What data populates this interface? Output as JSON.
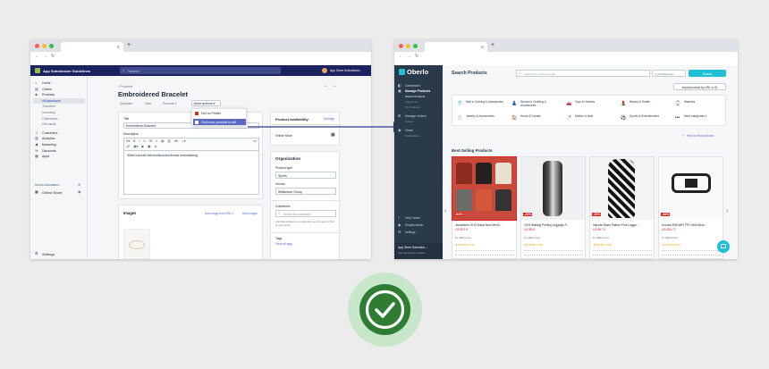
{
  "colors": {
    "shopify_topbar": "#1c2260",
    "oberlo_sidebar": "#2b3a4a",
    "oberlo_accent": "#1fc0d6",
    "arrow": "#2e3a8c",
    "check_circle": "#c8e6c9",
    "check_inner": "#2e7d32",
    "sale_red": "#e02020"
  },
  "left": {
    "topbar": {
      "store": "App Submission Guidelines",
      "search_placeholder": "Search",
      "account": "App Store Submission"
    },
    "nav": [
      {
        "label": "Home",
        "icon": "home-icon"
      },
      {
        "label": "Orders",
        "icon": "orders-icon"
      },
      {
        "label": "Products",
        "icon": "tag-icon"
      },
      {
        "label": "All products",
        "sub": true,
        "active": true
      },
      {
        "label": "Transfers",
        "sub": true
      },
      {
        "label": "Inventory",
        "sub": true
      },
      {
        "label": "Collections",
        "sub": true
      },
      {
        "label": "Gift cards",
        "sub": true
      },
      {
        "label": "Customers",
        "icon": "person-icon"
      },
      {
        "label": "Analytics",
        "icon": "chart-icon"
      },
      {
        "label": "Marketing",
        "icon": "megaphone-icon"
      },
      {
        "label": "Discounts",
        "icon": "discount-icon"
      },
      {
        "label": "Apps",
        "icon": "apps-icon"
      }
    ],
    "sales_channels": "SALES CHANNELS",
    "online_store": "Online Store",
    "settings": "Settings",
    "breadcrumb": "‹ Products",
    "title": "Embroidered Bracelet",
    "actions": {
      "duplicate": "Duplicate",
      "view": "View",
      "promote": "Promote ▾",
      "more": "More actions ▾"
    },
    "dropdown": [
      "Edit on Printful",
      "Find more products to sell"
    ],
    "form": {
      "title_label": "Title",
      "title_value": "Embroidered Bracelet",
      "description_label": "Description",
      "description_value": "Silver bracelet with multicolored thread embroidering"
    },
    "availability": {
      "heading": "Product availability",
      "manage": "Manage",
      "channel": "Online Store"
    },
    "organization": {
      "heading": "Organization",
      "type_label": "Product type",
      "type_value": "Sports",
      "vendor_label": "Vendor",
      "vendor_value": "Williamson Group",
      "collections_label": "Collections",
      "collections_placeholder": "Search for collections",
      "collections_help": "Add this product to a collection so it's easy to find in your store.",
      "tags_label": "Tags",
      "tags_link": "View all tags"
    },
    "images": {
      "heading": "Images",
      "add_url": "Add image from URL ▾",
      "add": "Add images"
    }
  },
  "right": {
    "logo": "Oberlo",
    "nav": [
      {
        "label": "Dashboard",
        "icon": "dashboard-icon"
      },
      {
        "label": "Manage Products",
        "icon": "box-icon",
        "active": true
      },
      {
        "label": "Search Products",
        "sub": true,
        "active": true
      },
      {
        "label": "Import List",
        "sub": true
      },
      {
        "label": "My Products",
        "sub": true
      },
      {
        "label": "Manage Orders",
        "icon": "cart-icon"
      },
      {
        "label": "Orders",
        "sub": true
      },
      {
        "label": "Views",
        "icon": "eye-icon"
      },
      {
        "label": "Notifications",
        "sub": true
      }
    ],
    "bottom_nav": [
      "Help Center",
      "Shopify Admin",
      "Settings"
    ],
    "store_name": "App Store Submissi...",
    "store_sub": "App Submission Guideli...",
    "heading": "Search Products",
    "search_placeholder": "Search for products to sell",
    "category_select": "In All Categories",
    "search_btn": "Search",
    "import_btn": "Import product by URL or ID",
    "categories": [
      {
        "label": "Men's Clothing & Accessories",
        "icon": "shirt-icon"
      },
      {
        "label": "Women's Clothing & Accessories",
        "icon": "dress-icon"
      },
      {
        "label": "Toys & Hobbies",
        "icon": "toy-icon"
      },
      {
        "label": "Beauty & Health",
        "icon": "lipstick-icon"
      },
      {
        "label": "Watches",
        "icon": "watch-icon"
      },
      {
        "label": "Jewelry & Accessories",
        "icon": "ring-icon"
      },
      {
        "label": "Home & Garden",
        "icon": "house-icon"
      },
      {
        "label": "Mother & Kids",
        "icon": "stroller-icon"
      },
      {
        "label": "Sports & Entertainment",
        "icon": "ball-icon"
      },
      {
        "label": "More categories ▾",
        "icon": "dots-icon"
      }
    ],
    "help_link": "Help on find products",
    "best_selling": "Best-Selling Products",
    "products": [
      {
        "name": "Jacksitems 2019 Brand New Men's...",
        "price": "US $17.9",
        "discount": "-64%",
        "seller": "by AliExpress",
        "rating": "★★★★★ (673)",
        "img": "shirts"
      },
      {
        "name": "2019 Walking Printing Leggings P...",
        "price": "US $6.5",
        "discount": "-29%",
        "seller": "by AliExpress",
        "rating": "★★★★★ (344)",
        "img": "leggings"
      },
      {
        "name": "Impulse Black Pattern Print Leggin...",
        "price": "US $6.73",
        "discount": "-30%",
        "seller": "by AliExpress",
        "rating": "★★★★★ (434)",
        "img": "legs"
      },
      {
        "name": "Kurutsa E58 WIFI FPV With Wide...",
        "price": "US $24.77",
        "discount": "-38%",
        "seller": "by AliExpress",
        "rating": "★★★★★ (412)",
        "img": "drone"
      }
    ]
  }
}
